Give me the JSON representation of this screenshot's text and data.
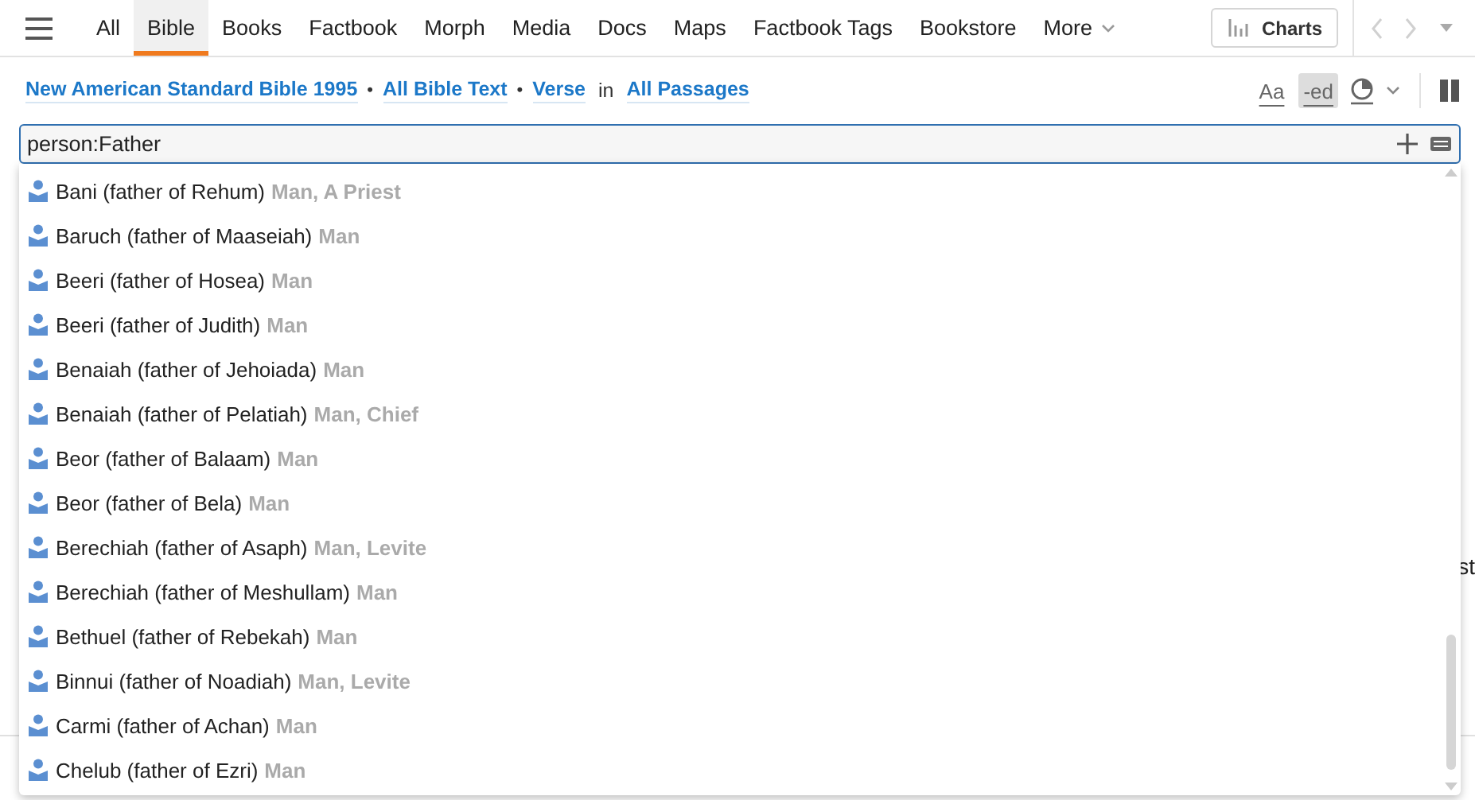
{
  "tabs": [
    {
      "label": "All",
      "selected": false
    },
    {
      "label": "Bible",
      "selected": true
    },
    {
      "label": "Books",
      "selected": false
    },
    {
      "label": "Factbook",
      "selected": false
    },
    {
      "label": "Morph",
      "selected": false
    },
    {
      "label": "Media",
      "selected": false
    },
    {
      "label": "Docs",
      "selected": false
    },
    {
      "label": "Maps",
      "selected": false
    },
    {
      "label": "Factbook Tags",
      "selected": false
    },
    {
      "label": "Bookstore",
      "selected": false
    },
    {
      "label": "More",
      "selected": false,
      "kind": "menu"
    }
  ],
  "charts_button": "Charts",
  "nav": {
    "back_disabled": true,
    "forward_disabled": true
  },
  "scope": [
    {
      "kind": "link",
      "text": "New American Standard Bible 1995"
    },
    {
      "kind": "separator",
      "text": "•"
    },
    {
      "kind": "link",
      "text": "All Bible Text"
    },
    {
      "kind": "separator",
      "text": "•"
    },
    {
      "kind": "link",
      "text": "Verse"
    },
    {
      "kind": "word",
      "text": "in"
    },
    {
      "kind": "bold-link",
      "text": "All Passages"
    }
  ],
  "view_tools": [
    {
      "label": "Aa",
      "selected": false
    },
    {
      "label": "-ed",
      "selected": true
    }
  ],
  "search": {
    "value": "person:Father"
  },
  "suggestions": [
    {
      "name": "Bani (father of Rehum)",
      "type": "Man, A Priest"
    },
    {
      "name": "Baruch (father of Maaseiah)",
      "type": "Man"
    },
    {
      "name": "Beeri (father of Hosea)",
      "type": "Man"
    },
    {
      "name": "Beeri (father of Judith)",
      "type": "Man"
    },
    {
      "name": "Benaiah (father of Jehoiada)",
      "type": "Man"
    },
    {
      "name": "Benaiah (father of Pelatiah)",
      "type": "Man, Chief"
    },
    {
      "name": "Beor (father of Balaam)",
      "type": "Man"
    },
    {
      "name": "Beor (father of Bela)",
      "type": "Man"
    },
    {
      "name": "Berechiah (father of Asaph)",
      "type": "Man, Levite"
    },
    {
      "name": "Berechiah (father of Meshullam)",
      "type": "Man"
    },
    {
      "name": "Bethuel (father of Rebekah)",
      "type": "Man"
    },
    {
      "name": "Binnui (father of Noadiah)",
      "type": "Man, Levite"
    },
    {
      "name": "Carmi (father of Achan)",
      "type": "Man"
    },
    {
      "name": "Chelub (father of Ezri)",
      "type": "Man"
    }
  ],
  "background_text": "st"
}
